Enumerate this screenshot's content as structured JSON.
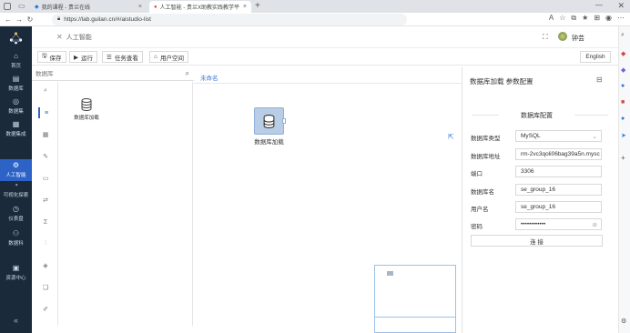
{
  "browser": {
    "tabs": [
      {
        "label": "我的课程 - 贵兰在线"
      },
      {
        "label": "人工智能 - 贵兰X助教实践教学平"
      }
    ],
    "url": "https://lab.guilan.cn/#/aistudio-list"
  },
  "app": {
    "breadcrumb": "人工智能",
    "user_name": "钟芸",
    "language": "English",
    "nav": [
      {
        "label": "首页",
        "icon": "home-icon"
      },
      {
        "label": "数据库",
        "icon": "database-icon"
      },
      {
        "label": "数据集",
        "icon": "dataset-icon"
      },
      {
        "label": "数据集成",
        "icon": "integration-icon"
      },
      {
        "label": "人工智能",
        "icon": "ai-icon"
      },
      {
        "label": "可视化探索",
        "icon": "chart-icon"
      },
      {
        "label": "仪表盘",
        "icon": "dashboard-icon"
      },
      {
        "label": "数据科",
        "icon": "flow-icon"
      },
      {
        "label": "资源中心",
        "icon": "resource-icon"
      }
    ],
    "collapse_icon": "«"
  },
  "toolbar": {
    "save": "保存",
    "run": "运行",
    "tasks": "任务查看",
    "space": "用户空间"
  },
  "left_panel": {
    "search_placeholder": "数据库",
    "palette_item": "数据库加载"
  },
  "canvas": {
    "tab": "未命名",
    "node_label": "数据库加载"
  },
  "config": {
    "title": "数据库加载 参数配置",
    "section": "数据库配置",
    "db_type_label": "数据库类型",
    "db_type_value": "MySQL",
    "db_addr_label": "数据库地址",
    "db_addr_value": "rm-2vc3qoli06bag39a5n.mysc",
    "port_label": "端口",
    "port_value": "3306",
    "db_name_label": "数据库名",
    "db_name_value": "se_group_16",
    "user_label": "用户名",
    "user_value": "se_group_16",
    "pwd_label": "密码",
    "pwd_value": "••••••••••••",
    "connect": "连 接"
  },
  "colors": {
    "nav_bg": "#1b2a3a",
    "accent": "#2d62c7",
    "canvas_link": "#3a7bd5"
  }
}
